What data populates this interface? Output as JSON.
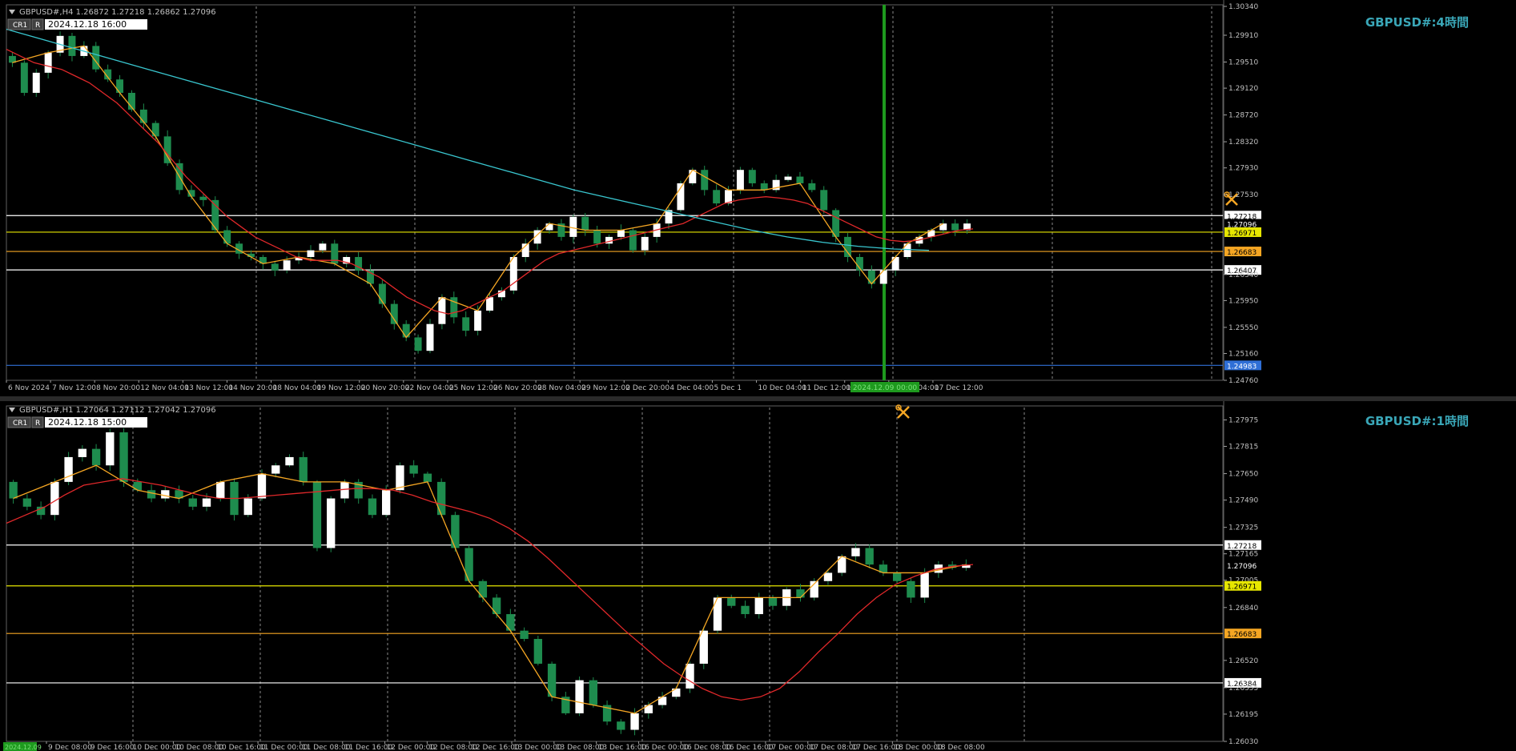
{
  "colors": {
    "background": "#000000",
    "bull_body": "#ffffff",
    "bear_body": "#1e8c4e",
    "wick": "#1e8c4e",
    "ma_fast": "#e0282a",
    "ma_slow": "#39c6cf",
    "zigzag": "#f5a623",
    "title_color": "#3aa7b8",
    "grid": "#8a8a8a",
    "level_white": "#ffffff",
    "level_yellow": "#e6e600",
    "level_orange": "#f5a623",
    "level_blue": "#2f6fd6",
    "vline_green": "#1e9a1e"
  },
  "panes": [
    {
      "id": "h4",
      "header": "GBPUSD#,H4  1.26872 1.27218 1.26862 1.27096",
      "cr_label": "CR1",
      "r_label": "R",
      "datetime": "2024.12.18 16:00",
      "title": "GBPUSD#:4時間",
      "icon": "crossed-tools-icon",
      "cursor_date": "2024.12.09 00:00",
      "price_ticks": [
        "1.30340",
        "1.29910",
        "1.29510",
        "1.29120",
        "1.28720",
        "1.28320",
        "1.27930",
        "1.27530",
        "1.27218",
        "1.27096",
        "1.26971",
        "1.26683",
        "1.26407",
        "1.26340",
        "1.25950",
        "1.25550",
        "1.25160",
        "1.24983",
        "1.24760"
      ],
      "x_labels": [
        "6 Nov 2024",
        "7 Nov 12:00",
        "8 Nov 20:00",
        "12 Nov 04:00",
        "13 Nov 12:00",
        "14 Nov 20:00",
        "18 Nov 04:00",
        "19 Nov 12:00",
        "20 Nov 20:00",
        "22 Nov 04:00",
        "25 Nov 12:00",
        "26 Nov 20:00",
        "28 Nov 04:00",
        "29 Nov 12:00",
        "2 Dec 20:00",
        "4 Dec 04:00",
        "5 Dec 1",
        "10 Dec 04:00",
        "11 Dec 12:00",
        "12 Dec 20:00",
        "16 Dec 04:00",
        "17 Dec 12:00"
      ],
      "levels": [
        {
          "price": "1.27218",
          "color": "white"
        },
        {
          "price": "1.26971",
          "color": "yellow"
        },
        {
          "price": "1.26683",
          "color": "orange"
        },
        {
          "price": "1.26407",
          "color": "white"
        },
        {
          "price": "1.24983",
          "color": "blue"
        }
      ],
      "current_price": "1.27096"
    },
    {
      "id": "h1",
      "header": "GBPUSD#,H1  1.27064 1.27112 1.27042 1.27096",
      "cr_label": "CR1",
      "r_label": "R",
      "datetime": "2024.12.18 15:00",
      "title": "GBPUSD#:1時間",
      "icon": "crossed-tools-icon",
      "price_ticks": [
        "1.27975",
        "1.27815",
        "1.27650",
        "1.27490",
        "1.27325",
        "1.27218",
        "1.27165",
        "1.27096",
        "1.27005",
        "1.26971",
        "1.26840",
        "1.26683",
        "1.26520",
        "1.26384",
        "1.26355",
        "1.26195",
        "1.26030"
      ],
      "x_labels": [
        "9 Dec 08:00",
        "9 Dec 16:00",
        "10 Dec 00:00",
        "10 Dec 08:00",
        "10 Dec 16:00",
        "11 Dec 00:00",
        "11 Dec 08:00",
        "11 Dec 16:00",
        "12 Dec 00:00",
        "12 Dec 08:00",
        "12 Dec 16:00",
        "13 Dec 00:00",
        "13 Dec 08:00",
        "13 Dec 16:00",
        "16 Dec 00:00",
        "16 Dec 08:00",
        "16 Dec 16:00",
        "17 Dec 00:00",
        "17 Dec 08:00",
        "17 Dec 16:00",
        "18 Dec 00:00",
        "18 Dec 08:00"
      ],
      "x_first_label": "2024.12.09",
      "levels": [
        {
          "price": "1.27218",
          "color": "white"
        },
        {
          "price": "1.26971",
          "color": "yellow"
        },
        {
          "price": "1.26683",
          "color": "orange"
        },
        {
          "price": "1.26384",
          "color": "white"
        }
      ],
      "current_price": "1.27096"
    }
  ],
  "chart_data": [
    {
      "type": "candlestick",
      "symbol": "GBPUSD#",
      "timeframe": "H4",
      "ylim": [
        1.2476,
        1.3034
      ],
      "series": [
        {
          "name": "close",
          "values": [
            1.295,
            1.2905,
            1.2935,
            1.2965,
            1.299,
            1.296,
            1.2975,
            1.294,
            1.2925,
            1.2905,
            1.288,
            1.286,
            1.284,
            1.28,
            1.276,
            1.275,
            1.2745,
            1.27,
            1.268,
            1.2665,
            1.266,
            1.265,
            1.264,
            1.2655,
            1.266,
            1.267,
            1.268,
            1.265,
            1.266,
            1.264,
            1.262,
            1.259,
            1.256,
            1.254,
            1.252,
            1.256,
            1.26,
            1.257,
            1.255,
            1.258,
            1.26,
            1.261,
            1.266,
            1.268,
            1.27,
            1.271,
            1.269,
            1.272,
            1.27,
            1.268,
            1.269,
            1.27,
            1.267,
            1.269,
            1.271,
            1.273,
            1.277,
            1.279,
            1.276,
            1.274,
            1.276,
            1.279,
            1.277,
            1.276,
            1.2775,
            1.278,
            1.277,
            1.276,
            1.273,
            1.269,
            1.266,
            1.264,
            1.262,
            1.264,
            1.266,
            1.268,
            1.269,
            1.27,
            1.271,
            1.27,
            1.271
          ]
        },
        {
          "name": "ma_fast",
          "values": [
            1.297,
            1.296,
            1.295,
            1.2945,
            1.294,
            1.293,
            1.292,
            1.2905,
            1.289,
            1.287,
            1.285,
            1.283,
            1.2805,
            1.278,
            1.276,
            1.274,
            1.272,
            1.2705,
            1.269,
            1.268,
            1.267,
            1.266,
            1.2655,
            1.2655,
            1.2655,
            1.265,
            1.264,
            1.263,
            1.2615,
            1.26,
            1.259,
            1.258,
            1.2575,
            1.258,
            1.259,
            1.26,
            1.261,
            1.2625,
            1.264,
            1.2655,
            1.2665,
            1.267,
            1.2675,
            1.268,
            1.2685,
            1.269,
            1.2695,
            1.27,
            1.2705,
            1.271,
            1.272,
            1.273,
            1.274,
            1.2745,
            1.2748,
            1.275,
            1.2748,
            1.2745,
            1.274,
            1.273,
            1.272,
            1.271,
            1.27,
            1.269,
            1.2685,
            1.2683,
            1.2685,
            1.269,
            1.2695,
            1.27,
            1.2702
          ]
        },
        {
          "name": "ma_slow",
          "values": [
            1.3,
            1.2985,
            1.297,
            1.2955,
            1.294,
            1.2925,
            1.291,
            1.2895,
            1.288,
            1.2865,
            1.285,
            1.2835,
            1.282,
            1.2805,
            1.279,
            1.2775,
            1.276,
            1.2748,
            1.2736,
            1.2724,
            1.2712,
            1.27,
            1.269,
            1.2682,
            1.2676,
            1.2672,
            1.267
          ]
        }
      ]
    },
    {
      "type": "candlestick",
      "symbol": "GBPUSD#",
      "timeframe": "H1",
      "ylim": [
        1.2603,
        1.2805
      ],
      "series": [
        {
          "name": "close",
          "values": [
            1.275,
            1.2745,
            1.274,
            1.276,
            1.2775,
            1.278,
            1.277,
            1.279,
            1.276,
            1.2755,
            1.275,
            1.2755,
            1.275,
            1.2745,
            1.275,
            1.276,
            1.274,
            1.275,
            1.2765,
            1.277,
            1.2775,
            1.276,
            1.272,
            1.275,
            1.276,
            1.275,
            1.274,
            1.2755,
            1.277,
            1.2765,
            1.276,
            1.274,
            1.272,
            1.27,
            1.269,
            1.268,
            1.267,
            1.2665,
            1.265,
            1.263,
            1.262,
            1.264,
            1.2625,
            1.2615,
            1.261,
            1.262,
            1.2625,
            1.263,
            1.2635,
            1.265,
            1.267,
            1.269,
            1.2685,
            1.268,
            1.269,
            1.2685,
            1.2695,
            1.269,
            1.27,
            1.2705,
            1.2715,
            1.272,
            1.271,
            1.2705,
            1.27,
            1.269,
            1.2705,
            1.271,
            1.2708,
            1.271
          ]
        },
        {
          "name": "ma",
          "values": [
            1.2735,
            1.274,
            1.2745,
            1.2752,
            1.2758,
            1.276,
            1.2762,
            1.276,
            1.2758,
            1.2755,
            1.2752,
            1.275,
            1.275,
            1.2751,
            1.2752,
            1.2753,
            1.2754,
            1.2755,
            1.2756,
            1.2756,
            1.2755,
            1.2752,
            1.2748,
            1.2745,
            1.2742,
            1.2738,
            1.2732,
            1.2724,
            1.2714,
            1.2703,
            1.2692,
            1.2681,
            1.267,
            1.266,
            1.265,
            1.2642,
            1.2635,
            1.263,
            1.2628,
            1.263,
            1.2635,
            1.2645,
            1.2657,
            1.2668,
            1.268,
            1.269,
            1.2698,
            1.2703,
            1.2707,
            1.2709,
            1.271
          ]
        }
      ]
    }
  ]
}
